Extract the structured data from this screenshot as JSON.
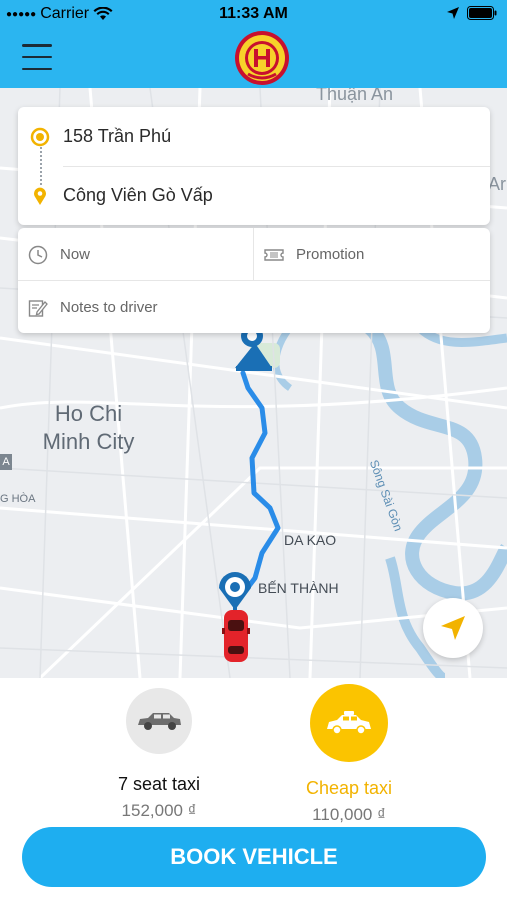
{
  "status_bar": {
    "carrier": "Carrier",
    "time": "11:33 AM"
  },
  "header": {
    "menu_icon": "hamburger-menu-icon",
    "logo": "company-logo"
  },
  "map": {
    "labels": {
      "city": "Ho Chi Minh City",
      "thuan_an": "Thuận An",
      "ar": "Ar",
      "da_kao": "DA KAO",
      "ben_thanh": "BẾN THÀNH",
      "song_sai_gon": "Sông Sài Gòn",
      "a_badge": "A",
      "hoa": "G HÒA"
    },
    "route_color": "#2a8ce8",
    "pickup_marker_color": "#1a6fb5",
    "car_color": "#e3232a"
  },
  "trip": {
    "from": "158 Trần Phú",
    "to": "Công Viên Gò Vấp"
  },
  "options": {
    "time": "Now",
    "promotion": "Promotion",
    "notes_placeholder": "Notes to driver"
  },
  "vehicles": [
    {
      "name": "7 seat taxi",
      "price": "152,000 ₫",
      "selected": false
    },
    {
      "name": "Cheap taxi",
      "price": "110,000 ₫",
      "selected": true
    }
  ],
  "book_button": "BOOK VEHICLE",
  "colors": {
    "primary": "#2bb5f0",
    "accent_yellow": "#fbc400",
    "button": "#1eaef0"
  }
}
